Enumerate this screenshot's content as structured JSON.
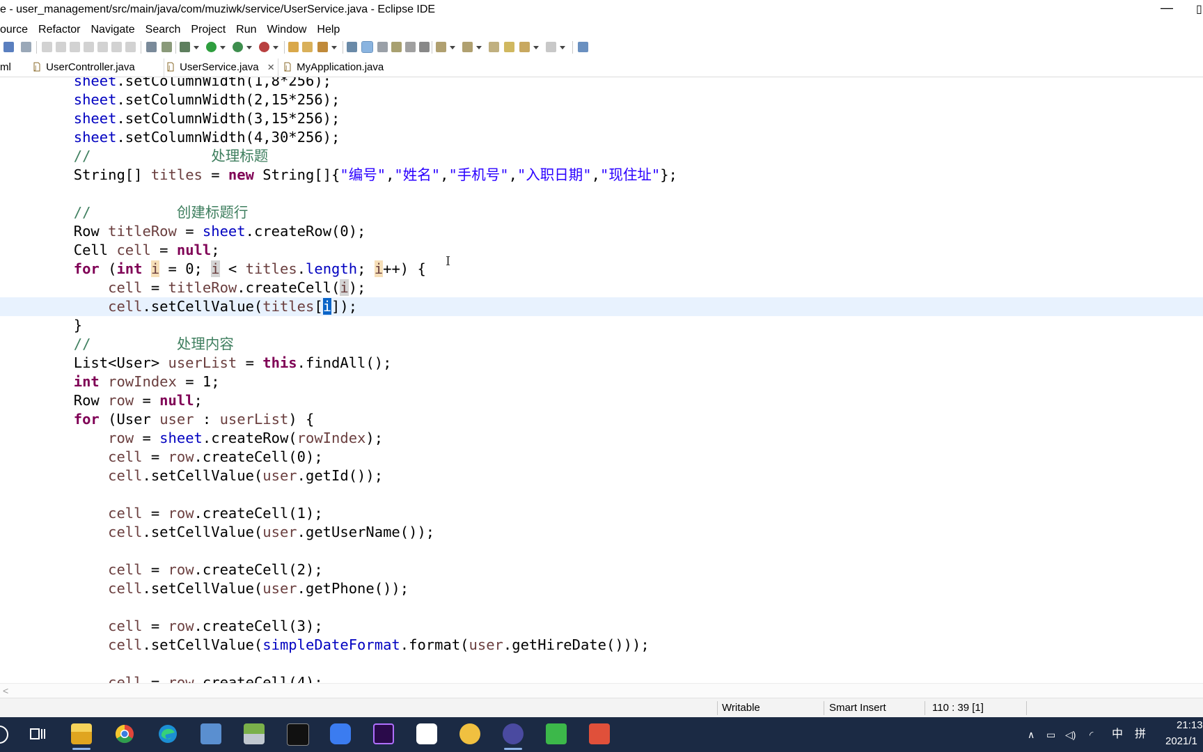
{
  "window": {
    "title": "e - user_management/src/main/java/com/muziwk/service/UserService.java - Eclipse IDE",
    "minimize_glyph": "—",
    "maximize_glyph": "▯"
  },
  "menu": [
    "ource",
    "Refactor",
    "Navigate",
    "Search",
    "Project",
    "Run",
    "Window",
    "Help"
  ],
  "tabs": [
    {
      "label": "ml",
      "active": false
    },
    {
      "label": "UserController.java",
      "active": false
    },
    {
      "label": "UserService.java",
      "active": true,
      "close": "✕"
    },
    {
      "label": "MyApplication.java",
      "active": false
    }
  ],
  "editor": {
    "lines": [
      "        sheet.setColumnWidth(1,8*256);",
      "        sheet.setColumnWidth(2,15*256);",
      "        sheet.setColumnWidth(3,15*256);",
      "        sheet.setColumnWidth(4,30*256);",
      "        //              处理标题",
      "        String[] titles = new String[]{\"编号\",\"姓名\",\"手机号\",\"入职日期\",\"现住址\"};",
      "",
      "        //          创建标题行",
      "        Row titleRow = sheet.createRow(0);",
      "        Cell cell = null;",
      "        for (int i = 0; i < titles.length; i++) {",
      "            cell = titleRow.createCell(i);",
      "            cell.setCellValue(titles[i]);",
      "        }",
      "        //          处理内容",
      "        List<User> userList = this.findAll();",
      "        int rowIndex = 1;",
      "        Row row = null;",
      "        for (User user : userList) {",
      "            row = sheet.createRow(rowIndex);",
      "            cell = row.createCell(0);",
      "            cell.setCellValue(user.getId());",
      "",
      "            cell = row.createCell(1);",
      "            cell.setCellValue(user.getUserName());",
      "",
      "            cell = row.createCell(2);",
      "            cell.setCellValue(user.getPhone());",
      "",
      "            cell = row.createCell(3);",
      "            cell.setCellValue(simpleDateFormat.format(user.getHireDate()));",
      "",
      "            cell = row.createCell(4);"
    ],
    "current_line_index": 12,
    "text_cursor": "I"
  },
  "status": {
    "writable": "Writable",
    "insert_mode": "Smart Insert",
    "position": "110 : 39 [1]"
  },
  "taskbar": {
    "ime_lang": "中",
    "ime_mode": "拼",
    "time": "21:13",
    "date": "2021/1"
  },
  "colors": {
    "keyword": "#7f0055",
    "field": "#0000c0",
    "string": "#2a00ff",
    "comment": "#3f7f5f",
    "local_var": "#6a3e3e",
    "current_line": "#e8f2fe",
    "selection": "#0a64c8",
    "taskbar": "#1b2a44"
  },
  "icons": [
    "search-icon",
    "java-file-icon",
    "close-tab-icon",
    "windows-start-icon",
    "task-view-icon",
    "file-explorer-icon",
    "chrome-icon",
    "edge-icon",
    "control-panel-icon",
    "notes-app-icon",
    "terminal-icon",
    "feishu-icon",
    "premiere-icon",
    "typora-icon",
    "yellow-app-icon",
    "eclipse-icon",
    "camtasia-green-icon",
    "camtasia-red-icon"
  ]
}
